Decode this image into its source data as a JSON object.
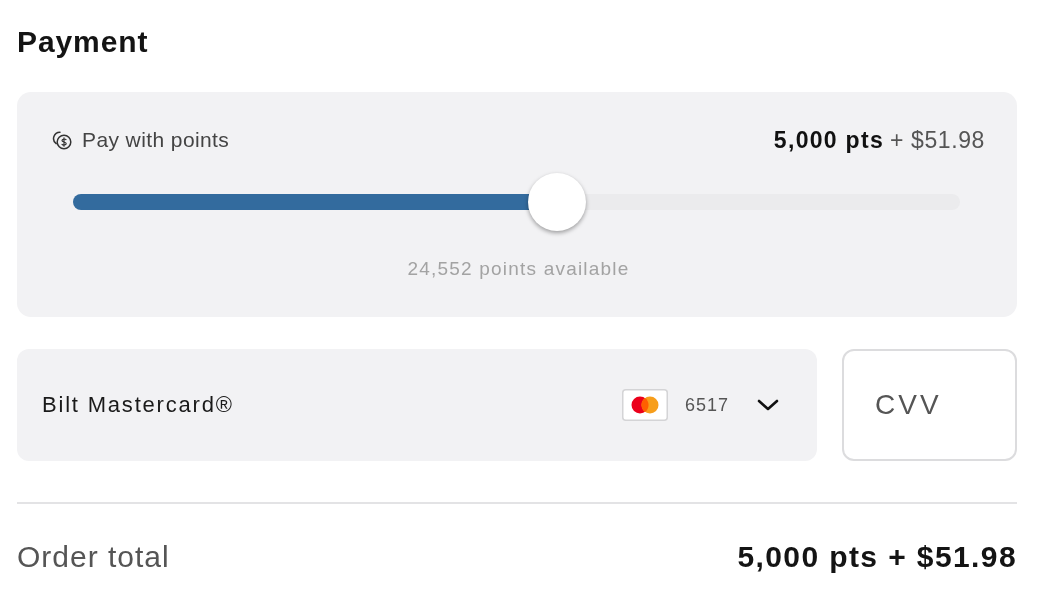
{
  "title": "Payment",
  "points": {
    "label": "Pay with points",
    "points_amount": "5,000 pts",
    "cash_amount": "+ $51.98",
    "level": 0.546,
    "available": "24,552 points available"
  },
  "card": {
    "name": "Bilt Mastercard®",
    "last_four": "6517"
  },
  "cvv": {
    "placeholder": "CVV"
  },
  "order_total": {
    "label": "Order total",
    "value": "5,000 pts + $51.98"
  }
}
